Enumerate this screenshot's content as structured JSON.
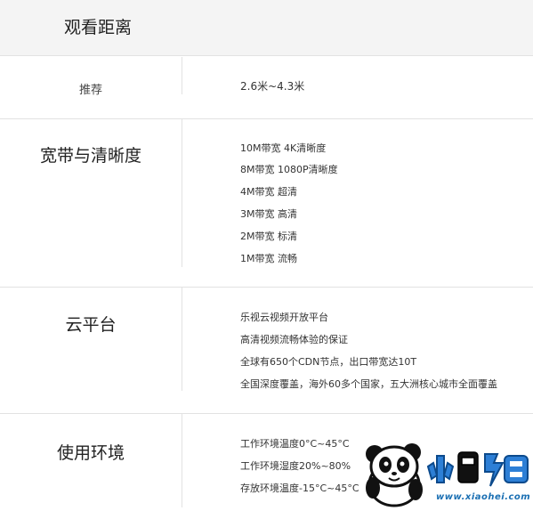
{
  "sections": {
    "distance": {
      "title": "观看距离",
      "sub_label": "推荐",
      "value": "2.6米~4.3米"
    },
    "bandwidth": {
      "title": "宽带与清晰度",
      "lines": [
        "10M带宽 4K清晰度",
        "8M带宽 1080P清晰度",
        "4M带宽 超清",
        "3M带宽 高清",
        "2M带宽 标清",
        "1M带宽 流畅"
      ]
    },
    "cloud": {
      "title": "云平台",
      "lines": [
        "乐视云视频开放平台",
        "高清视频流畅体验的保证",
        "全球有650个CDN节点，出口带宽达10T",
        "全国深度覆盖，海外60多个国家，五大洲核心城市全面覆盖"
      ]
    },
    "environment": {
      "title": "使用环境",
      "lines": [
        "工作环境温度0°C~45°C",
        "工作环境湿度20%~80%",
        "存放环境温度-15°C~45°C"
      ]
    }
  },
  "watermark": {
    "brand_text": "小黑游戏",
    "url": "www.xiaohei.com",
    "icon": "panda-mascot-icon"
  }
}
